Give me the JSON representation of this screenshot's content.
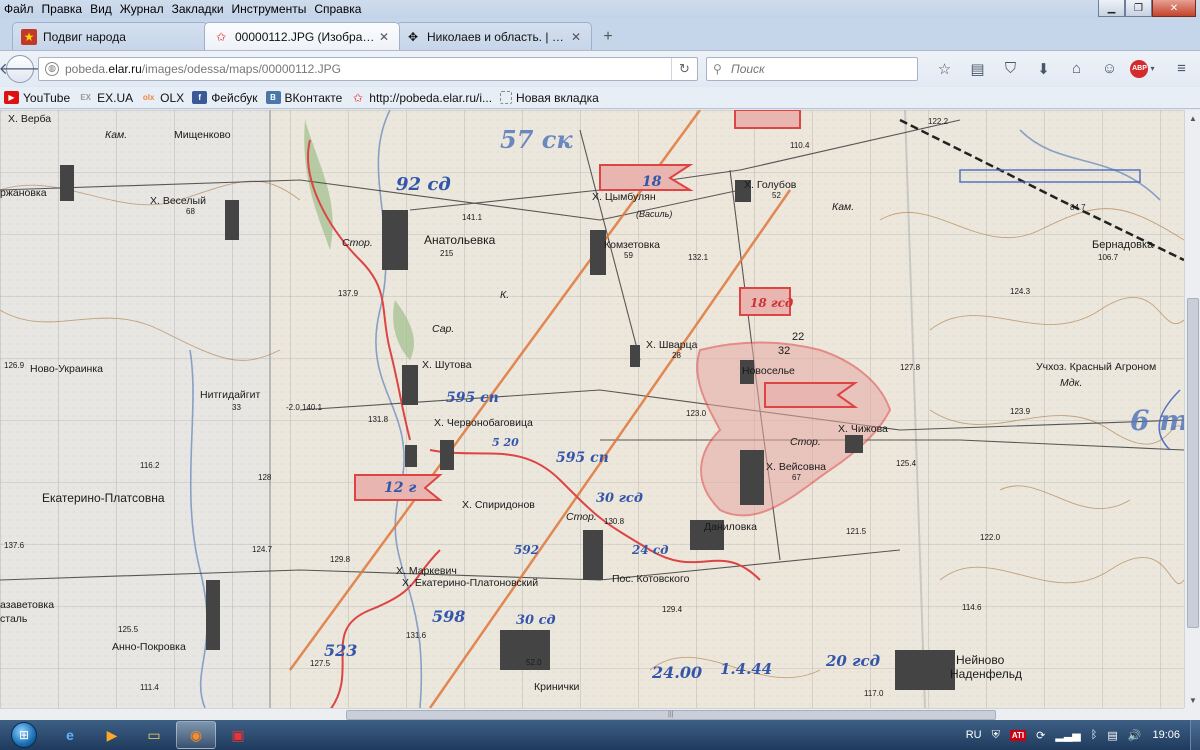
{
  "menu": [
    "Файл",
    "Правка",
    "Вид",
    "Журнал",
    "Закладки",
    "Инструменты",
    "Справка"
  ],
  "window_controls": {
    "minimize": "▁",
    "maximize": "❐",
    "close": "✕"
  },
  "tabs": [
    {
      "title": "Подвиг народа",
      "icon": "star-logo-icon",
      "active": false
    },
    {
      "title": "00000112.JPG (Изображен...",
      "icon": "star-icon",
      "active": true
    },
    {
      "title": "Николаев и область. | Стр...",
      "icon": "move-icon",
      "active": false
    }
  ],
  "newtab_label": "+",
  "nav": {
    "url_prefix": "pobeda.",
    "url_domain": "elar.ru",
    "url_path": "/images/odessa/maps/00000112.JPG",
    "search_placeholder": "Поиск"
  },
  "bookmarks": [
    {
      "label": "YouTube",
      "icon": "youtube-icon",
      "color": "#d11"
    },
    {
      "label": "EX.UA",
      "icon": "ex-icon",
      "color": "#999"
    },
    {
      "label": "OLX",
      "icon": "olx-icon",
      "color": "#e84"
    },
    {
      "label": "Фейсбук",
      "icon": "facebook-icon",
      "color": "#3b5998"
    },
    {
      "label": "ВКонтакте",
      "icon": "vk-icon",
      "color": "#4a76a8"
    },
    {
      "label": "http://pobeda.elar.ru/i...",
      "icon": "star-icon",
      "color": "#d22"
    },
    {
      "label": "Новая вкладка",
      "icon": "page-icon",
      "color": "#fff"
    }
  ],
  "map_labels": {
    "verba": "Х. Верба",
    "mishchenkovo": "Мищенково",
    "kam1": "Кам.",
    "k": "К.",
    "zhanovka": "ржановка",
    "veseliy": "Х. Веселый",
    "n68": "68",
    "div92": "92 сд",
    "ck57": "57 ск",
    "anatolevka": "Анатольевка",
    "n215": "215",
    "stor": "Стор.",
    "n137_9": "137.9",
    "n141_1": "141.1",
    "cymbulyan": "Х. Цымбулян",
    "vasil": "(Василь)",
    "golubov": "Х. Голубов",
    "n52": "52",
    "n110_4": "110.4",
    "n122_2": "122.2",
    "k18": "18",
    "komsetovka": "Комзетовка",
    "n59": "59",
    "n132_1": "132.1",
    "bernadovka": "Бернадовка",
    "n106_7": "106.7",
    "n84_7": "84.7",
    "n124_3": "124.3",
    "div18": "18 гсд",
    "n22": "22",
    "n32": "32",
    "sar": "Сар.",
    "novoukr": "Ново-Украинка",
    "n126_9": "126.9",
    "shutova": "Х. Шутова",
    "shvarca": "Х. Шварца",
    "n28": "28",
    "noveselye": "Новоселье",
    "krasny": "Учхоз. Красный Агроном",
    "mdk": "Мдк.",
    "n127_8": "127.8",
    "nitgid": "Нитгидайгит",
    "n33": "33",
    "n140_1": "-2.0 140.1",
    "sp595a": "595 сп",
    "chervon": "Х. Червонобаговица",
    "n131_8": "131.8",
    "n123_0": "123.0",
    "chizhova": "Х. Чижова",
    "veisovna": "Х. Вейсовна",
    "n67": "67",
    "n125_4": "125.4",
    "n123_9": "123.9",
    "n6": "6 т",
    "n116_2": "116.2",
    "n128": "128",
    "sp595b": "595 сп",
    "div12": "12 г",
    "ekplat": "Екатерино-Платсовна",
    "spiridonov": "Х. Спиридонов",
    "div30": "30 гсд",
    "danilovka": "Даниловка",
    "n130_8": "130.8",
    "n121_5": "121.5",
    "n122_0": "122.0",
    "n137_6": "137.6",
    "n124_7": "124.7",
    "n129_8": "129.8",
    "markevich": "Х. Маркевич",
    "ekplat2": "Х. Екатерино-Платоновский",
    "kotovskogo": "Пос. Котовского",
    "n24": "24 сд",
    "zavetovka": "азаветовка",
    "stal": "сталь",
    "n125_5": "125.5",
    "n129_4": "129.4",
    "n114_6": "114.6",
    "annopokr": "Анно-Покровка",
    "n598": "598",
    "div30b": "30 сд",
    "n131_6": "131.6",
    "n127_5": "127.5",
    "n523": "523",
    "krinichki": "Кринички",
    "n24_00": "24.00",
    "n1_4_44": "1.4.44",
    "div20": "20 гсд",
    "neinovo": "Нейново",
    "nadenfeld": "Наденфельд",
    "n117_0": "117.0",
    "n111_4": "111.4",
    "n52_0": "52.0",
    "n592": "592",
    "n520": "5 20"
  },
  "tray": {
    "lang": "RU",
    "ati": "ATI",
    "time": "19:06"
  }
}
